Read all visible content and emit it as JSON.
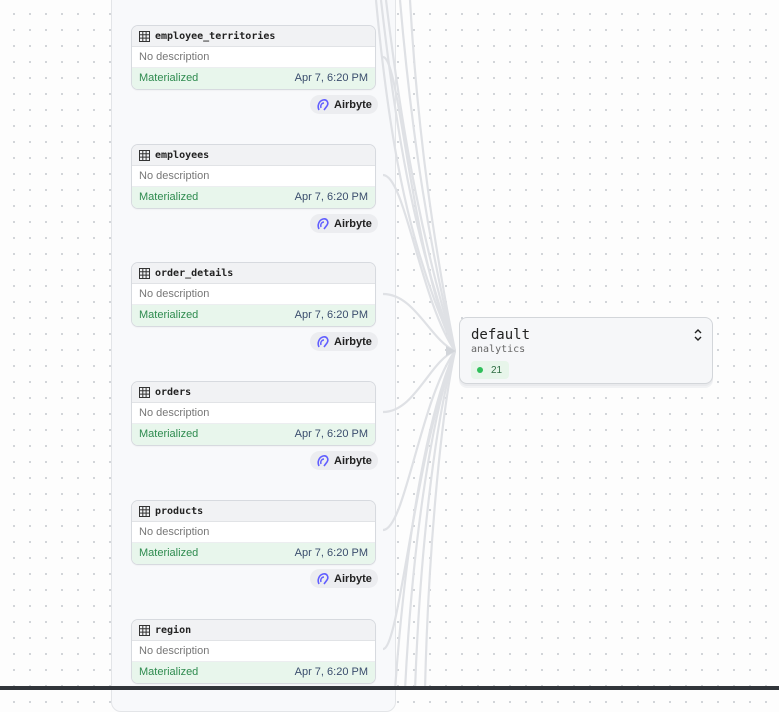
{
  "nodes": [
    {
      "name": "employee_territories",
      "description": "No description",
      "status": "Materialized",
      "timestamp": "Apr 7, 6:20 PM",
      "source": "Airbyte"
    },
    {
      "name": "employees",
      "description": "No description",
      "status": "Materialized",
      "timestamp": "Apr 7, 6:20 PM",
      "source": "Airbyte"
    },
    {
      "name": "order_details",
      "description": "No description",
      "status": "Materialized",
      "timestamp": "Apr 7, 6:20 PM",
      "source": "Airbyte"
    },
    {
      "name": "orders",
      "description": "No description",
      "status": "Materialized",
      "timestamp": "Apr 7, 6:20 PM",
      "source": "Airbyte"
    },
    {
      "name": "products",
      "description": "No description",
      "status": "Materialized",
      "timestamp": "Apr 7, 6:20 PM",
      "source": "Airbyte"
    },
    {
      "name": "region",
      "description": "No description",
      "status": "Materialized",
      "timestamp": "Apr 7, 6:20 PM",
      "source": ""
    }
  ],
  "target": {
    "title": "default",
    "subtitle": "analytics",
    "count": "21",
    "status_color": "#2fbf5a",
    "icon": "chevron-up-down-icon"
  },
  "colors": {
    "materialized_bg": "#e8f6ec",
    "materialized_text": "#2e8b4f",
    "edge": "#dfe1e5"
  }
}
